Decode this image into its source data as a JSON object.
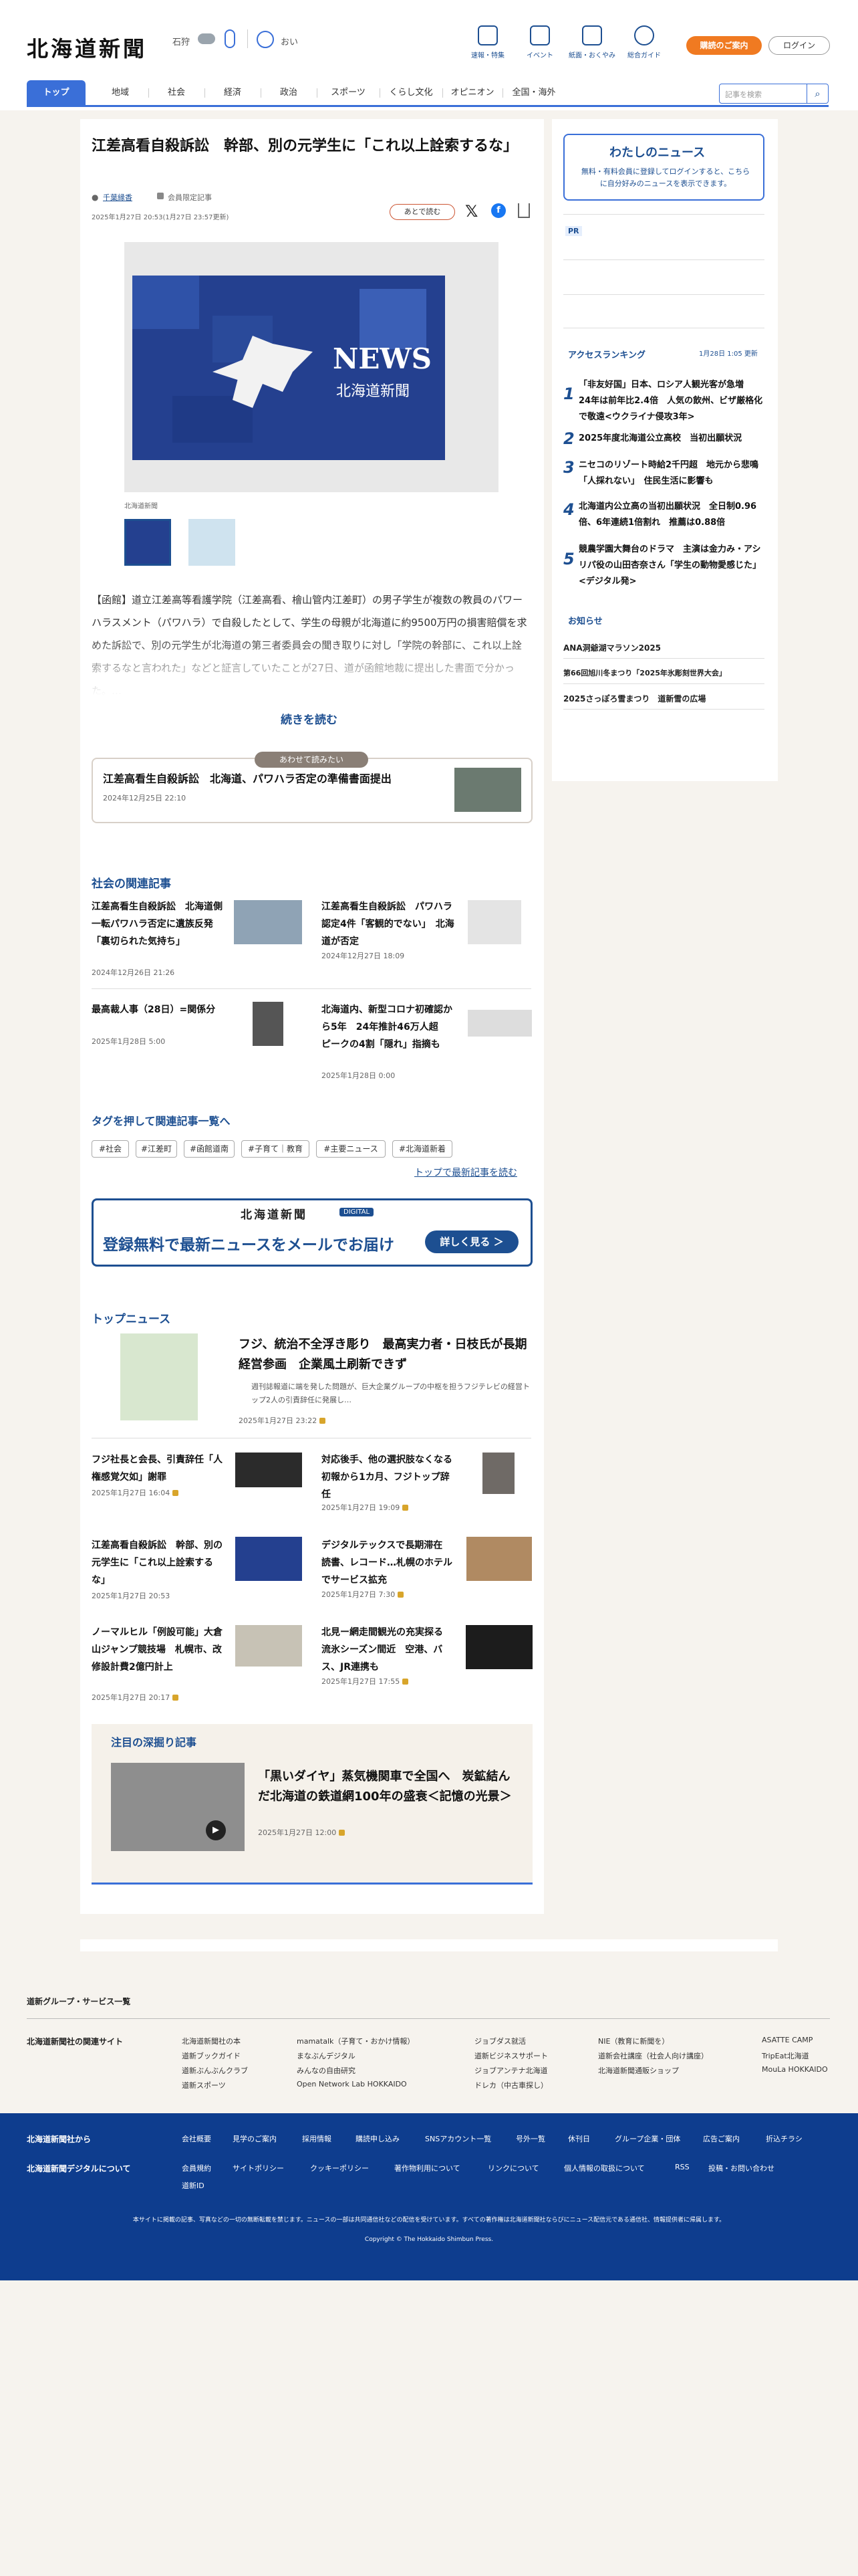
{
  "header": {
    "logo": "北海道新聞",
    "weather_city": "石狩",
    "weather_label": "おい",
    "icons": [
      {
        "label": "速報・特集",
        "icon": "flag-icon"
      },
      {
        "label": "イベント",
        "icon": "calendar-icon"
      },
      {
        "label": "紙面・おくやみ",
        "icon": "newspaper-icon"
      },
      {
        "label": "総合ガイド",
        "icon": "help-icon"
      }
    ],
    "subscribe_label": "購読のご案内",
    "login_label": "ログイン"
  },
  "nav": {
    "items": [
      "トップ",
      "地域",
      "社会",
      "経済",
      "政治",
      "スポーツ",
      "くらし文化",
      "オピニオン",
      "全国・海外"
    ],
    "search_placeholder": "記事を検索"
  },
  "article": {
    "title": "江差高看自殺訴訟　幹部、別の元学生に「これ以上詮索するな」",
    "author": "千葉縁香",
    "category": "会員限定記事",
    "dates": "2025年1月27日 20:53(1月27日 23:57更新)",
    "save_label": "あとで読む",
    "image_caption": "北海道新聞",
    "news_label": "NEWS",
    "news_sub": "北海道新聞",
    "body": "【函館】道立江差高等看護学院（江差高看、檜山管内江差町）の男子学生が複数の教員のパワーハラスメント（パワハラ）で自殺したとして、学生の母親が北海道に約9500万円の損害賠償を求めた訴訟で、別の元学生が北海道の第三者委員会の聞き取りに対し「学院の幹部に、これ以上詮索するなと言われた」などと証言していたことが27日、道が函館地裁に提出した書面で分かった。…",
    "continue_label": "続きを読む"
  },
  "also_read": {
    "badge": "あわせて読みたい",
    "title": "江差高看生自殺訴訟　北海道、パワハラ否定の準備書面提出",
    "date": "2024年12月25日 22:10"
  },
  "related": {
    "heading": "社会の関連記事",
    "items": [
      {
        "title": "江差高看生自殺訴訟　北海道側一転パワハラ否定に遺族反発　「裏切られた気持ち」",
        "date": "2024年12月26日 21:26"
      },
      {
        "title": "江差高看生自殺訴訟　パワハラ認定4件「客観的でない」　北海道が否定",
        "date": "2024年12月27日 18:09"
      },
      {
        "title": "最高裁人事（28日）=関係分",
        "date": "2025年1月28日 5:00"
      },
      {
        "title": "北海道内、新型コロナ初確認から5年　24年推計46万人超　ピークの4割「隠れ」指摘も",
        "date": "2025年1月28日 0:00"
      }
    ]
  },
  "tags": {
    "heading": "タグを押して関連記事一覧へ",
    "items": [
      "#社会",
      "#江差町",
      "#函館道南",
      "#子育て｜教育",
      "#主要ニュース",
      "#北海道新着"
    ],
    "more_label": "トップで最新記事を読む"
  },
  "banner": {
    "logo": "北海道新聞",
    "digital": "DIGITAL",
    "text": "登録無料で最新ニュースをメールでお届け",
    "button": "詳しく見る ＞"
  },
  "top_news": {
    "heading": "トップニュース",
    "lead": {
      "title": "フジ、統治不全浮き彫り　最高実力者・日枝氏が長期経営参画　企業風土刷新できず",
      "desc": "週刊誌報道に端を発した問題が、巨大企業グループの中枢を担うフジテレビの経営トップ2人の引責辞任に発展し…",
      "date": "2025年1月27日 23:22"
    },
    "items": [
      {
        "title": "フジ社長と会長、引責辞任「人権感覚欠如」謝罪",
        "date": "2025年1月27日 16:04"
      },
      {
        "title": "対応後手、他の選択肢なくなる　初報から1カ月、フジトップ辞任",
        "date": "2025年1月27日 19:09"
      },
      {
        "title": "江差高看自殺訴訟　幹部、別の元学生に「これ以上詮索するな」",
        "date": "2025年1月27日 20:53"
      },
      {
        "title": "デジタルテックスで長期滞在　読書、レコード…札幌のホテルでサービス拡充",
        "date": "2025年1月27日 7:30"
      },
      {
        "title": "ノーマルヒル「例設可能」大倉山ジャンプ競技場　札幌市、改修設計費2億円計上",
        "date": "2025年1月27日 20:17"
      },
      {
        "title": "北見ー網走間観光の充実探る　流氷シーズン間近　空港、バス、JR連携も",
        "date": "2025年1月27日 17:55"
      }
    ]
  },
  "deep": {
    "heading": "注目の深掘り記事",
    "title": "「黒いダイヤ」蒸気機関車で全国へ　炭鉱結んだ北海道の鉄道網100年の盛衰＜記憶の光景＞",
    "date": "2025年1月27日 12:00"
  },
  "sidebar": {
    "my_news_title": "わたしのニュース",
    "my_news_text": "無料・有料会員に登録してログインすると、こちらに自分好みのニュースを表示できます。",
    "pr": "PR",
    "ranking_title": "アクセスランキング",
    "ranking_updated": "1月28日 1:05 更新",
    "ranking": [
      "「非友好国」日本、ロシア人観光客が急増　24年は前年比2.4倍　人気の飲州、ビザ厳格化で敬遠<ウクライナ侵攻3年>",
      "2025年度北海道公立高校　当初出願状況",
      "ニセコのリゾート時給2千円超　地元から悲鳴「人採れない」　住民生活に影響も",
      "北海道内公立高の当初出願状況　全日制0.96倍、6年連続1倍割れ　推薦は0.88倍",
      "競農学園大舞台のドラマ　主演は金力み・アシリパ役の山田杏奈さん「学生の動物愛感じた」<デジタル発>"
    ],
    "notice_title": "お知らせ",
    "notices": [
      "ANA洞爺湖マラソン2025",
      "第66回旭川冬まつり「2025年氷彫刻世界大会」",
      "2025さっぽろ雪まつり　道新雪の広場"
    ]
  },
  "group": {
    "title": "道新グループ・サービス一覧",
    "label": "北海道新聞社の関連サイト",
    "cols": [
      [
        "北海道新聞社の本",
        "道新ブックガイド",
        "道新ぶんぶんクラブ",
        "道新スポーツ"
      ],
      [
        "mamatalk（子育て・おかけ情報）",
        "まなぶんデジタル",
        "みんなの自由研究",
        "Open Network Lab HOKKAIDO"
      ],
      [
        "ジョブダス就活",
        "道新ビジネスサポート",
        "ジョブアンテナ北海道",
        "ドレカ（中古車探し）"
      ],
      [
        "NIE（教育に新聞を）",
        "道新会社講座（社会人向け講座）",
        "北海道新聞通販ショップ"
      ],
      [
        "ASATTE CAMP",
        "TripEat北海道",
        "MouLa HOKKAIDO"
      ]
    ]
  },
  "footer": {
    "left1": "北海道新聞社から",
    "left2": "北海道新聞デジタルについて",
    "row1": [
      "会社概要",
      "見学のご案内",
      "採用情報",
      "購読申し込み",
      "SNSアカウント一覧",
      "号外一覧",
      "休刊日",
      "グループ企業・団体",
      "広告ご案内",
      "折込チラシ"
    ],
    "row2": [
      "会員規約",
      "サイトポリシー",
      "クッキーポリシー",
      "著作物利用について",
      "リンクについて",
      "個人情報の取扱について",
      "RSS",
      "投稿・お問い合わせ",
      "道新ID"
    ],
    "notice": "本サイトに掲載の記事、写真などの一切の無断転載を禁じます。ニュースの一部は共同通信社などの配信を受けています。すべての著作権は北海道新聞社ならびにニュース配信元である通信社、情報提供者に帰属します。",
    "copyright": "Copyright © The Hokkaido Shimbun Press."
  },
  "colors": {
    "brand": "#1d4f91",
    "accent": "#3a6fd8",
    "orange": "#f07a21",
    "footer": "#0e3d8e"
  }
}
